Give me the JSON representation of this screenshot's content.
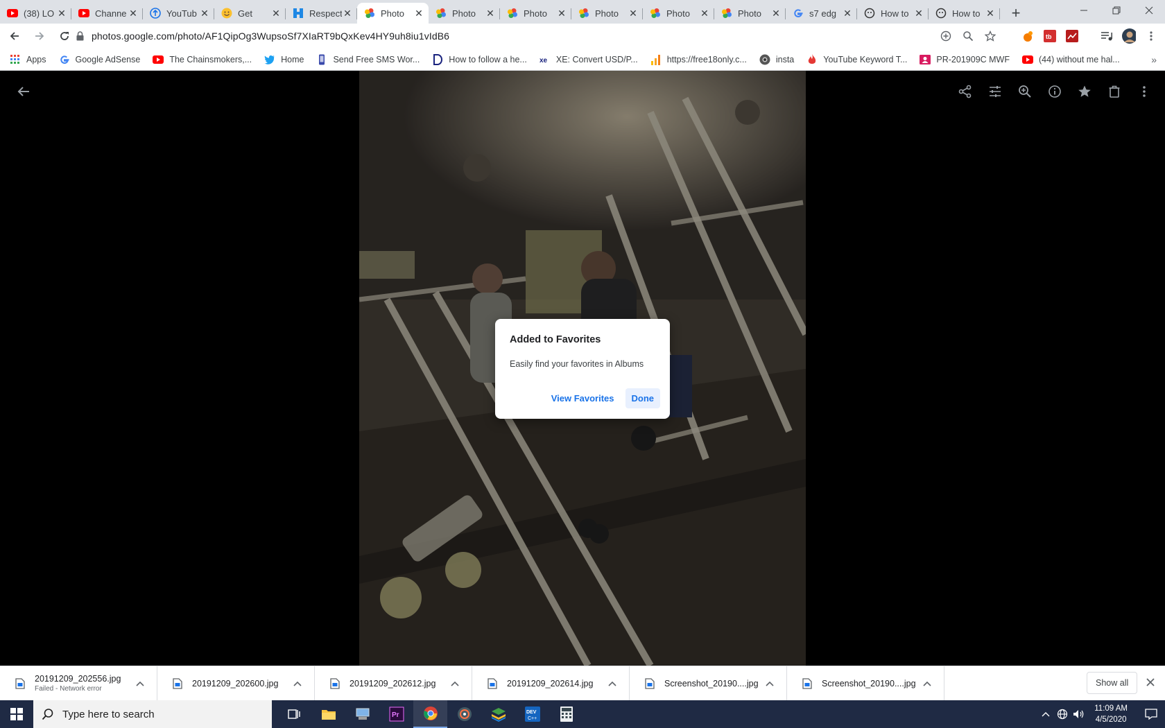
{
  "tabs": [
    {
      "title": "(38) LO",
      "icon": "youtube-icon",
      "active": false
    },
    {
      "title": "Channe",
      "icon": "youtube-icon",
      "active": false
    },
    {
      "title": "YouTub",
      "icon": "upload-icon",
      "active": false
    },
    {
      "title": "Get",
      "icon": "emoji-icon",
      "active": false
    },
    {
      "title": "Respect",
      "icon": "hubpages-icon",
      "active": false
    },
    {
      "title": "Photo",
      "icon": "google-photos-icon",
      "active": true
    },
    {
      "title": "Photo",
      "icon": "google-photos-icon",
      "active": false
    },
    {
      "title": "Photo",
      "icon": "google-photos-icon",
      "active": false
    },
    {
      "title": "Photo",
      "icon": "google-photos-icon",
      "active": false
    },
    {
      "title": "Photo",
      "icon": "google-photos-icon",
      "active": false
    },
    {
      "title": "Photo",
      "icon": "google-photos-icon",
      "active": false
    },
    {
      "title": "s7 edg",
      "icon": "google-icon",
      "active": false
    },
    {
      "title": "How to",
      "icon": "wikihow-icon",
      "active": false
    },
    {
      "title": "How to",
      "icon": "wikihow-icon",
      "active": false
    }
  ],
  "address_bar": {
    "url": "photos.google.com/photo/AF1QipOg3WupsoSf7XIaRT9bQxKev4HY9uh8iu1vIdB6"
  },
  "bookmarks": [
    {
      "label": "Apps",
      "icon": "apps-grid-icon"
    },
    {
      "label": "Google AdSense",
      "icon": "google-icon"
    },
    {
      "label": "The Chainsmokers,...",
      "icon": "youtube-icon"
    },
    {
      "label": "Home",
      "icon": "twitter-icon"
    },
    {
      "label": "Send Free SMS Wor...",
      "icon": "phone-icon"
    },
    {
      "label": "How to follow a he...",
      "icon": "d-icon"
    },
    {
      "label": "XE: Convert USD/P...",
      "icon": "xe-icon"
    },
    {
      "label": "https://free18only.c...",
      "icon": "chart-bars-icon"
    },
    {
      "label": "insta",
      "icon": "camera-icon"
    },
    {
      "label": "YouTube Keyword T...",
      "icon": "flame-icon"
    },
    {
      "label": "PR-201909C MWF",
      "icon": "contact-icon"
    },
    {
      "label": "(44) without me hal...",
      "icon": "youtube-icon"
    }
  ],
  "dialog": {
    "title": "Added to Favorites",
    "body": "Easily find your favorites in Albums",
    "view_label": "View Favorites",
    "done_label": "Done"
  },
  "downloads": [
    {
      "name": "20191209_202556.jpg",
      "status": "Failed - Network error"
    },
    {
      "name": "20191209_202600.jpg",
      "status": ""
    },
    {
      "name": "20191209_202612.jpg",
      "status": ""
    },
    {
      "name": "20191209_202614.jpg",
      "status": ""
    },
    {
      "name": "Screenshot_20190....jpg",
      "status": ""
    },
    {
      "name": "Screenshot_20190....jpg",
      "status": ""
    }
  ],
  "downloads_show_all": "Show all",
  "taskbar": {
    "search_placeholder": "Type here to search",
    "time": "11:09 AM",
    "date": "4/5/2020"
  },
  "colors": {
    "accent": "#1a73e8",
    "tab_bar": "#dee1e6",
    "taskbar": "#1f2a44"
  }
}
